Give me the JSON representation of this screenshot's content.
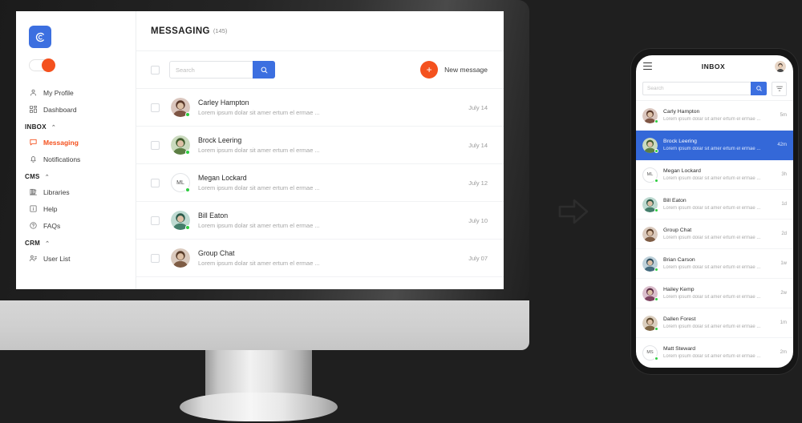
{
  "colors": {
    "accent_orange": "#f4511e",
    "accent_blue": "#3c6fe0",
    "selected_blue": "#3468d8",
    "online_green": "#2ecc40",
    "background": "#1f1f1f"
  },
  "desktop": {
    "sidebar": {
      "logo_letter": "C",
      "toggle_state": "on",
      "items": [
        {
          "label": "My Profile",
          "icon": "user-icon",
          "active": false
        },
        {
          "label": "Dashboard",
          "icon": "grid-icon",
          "active": false
        }
      ],
      "groups": [
        {
          "label": "INBOX",
          "chevron": "⌃",
          "items": [
            {
              "label": "Messaging",
              "icon": "chat-bubble-icon",
              "active": true
            },
            {
              "label": "Notifications",
              "icon": "bell-icon",
              "active": false
            }
          ]
        },
        {
          "label": "CMS",
          "chevron": "⌃",
          "items": [
            {
              "label": "Libraries",
              "icon": "books-icon",
              "active": false
            },
            {
              "label": "Help",
              "icon": "info-box-icon",
              "active": false
            },
            {
              "label": "FAQs",
              "icon": "question-circle-icon",
              "active": false
            }
          ]
        },
        {
          "label": "CRM",
          "chevron": "⌃",
          "items": [
            {
              "label": "User List",
              "icon": "user-list-icon",
              "active": false
            }
          ]
        }
      ]
    },
    "header": {
      "title": "MESSAGING",
      "count": "(145)"
    },
    "toolbar": {
      "select_all_checked": false,
      "search_value": "",
      "search_placeholder": "Search",
      "search_icon": "search-icon",
      "new_message_label": "New message",
      "new_message_icon": "plus-icon"
    },
    "messages": [
      {
        "name": "Carley Hampton",
        "preview": "Lorem ipsum dolar sit amer ertum el ermae ...",
        "date": "July 14",
        "avatar_type": "photo",
        "avatar_hue": 18,
        "online": true,
        "checked": false
      },
      {
        "name": "Brock Leering",
        "preview": "Lorem ipsum dolar sit amer ertum el ermae ...",
        "date": "July 14",
        "avatar_type": "photo",
        "avatar_hue": 95,
        "online": true,
        "checked": false
      },
      {
        "name": "Megan Lockard",
        "preview": "Lorem ipsum dolar sit amer ertum el ermae ...",
        "date": "July 12",
        "avatar_type": "initials",
        "initials": "ML",
        "online": true,
        "checked": false
      },
      {
        "name": "Bill Eaton",
        "preview": "Lorem ipsum dolar sit amer ertum el ermae ...",
        "date": "July 10",
        "avatar_type": "photo",
        "avatar_hue": 160,
        "online": true,
        "checked": false
      },
      {
        "name": "Group Chat",
        "preview": "Lorem ipsum dolar sit amer ertum el ermae ...",
        "date": "July 07",
        "avatar_type": "photo",
        "avatar_hue": 25,
        "online": false,
        "checked": false
      }
    ]
  },
  "mobile": {
    "header": {
      "title": "INBOX",
      "menu_icon": "hamburger-icon",
      "avatar": "user-avatar"
    },
    "search": {
      "value": "",
      "placeholder": "Search",
      "search_icon": "search-icon",
      "filter_icon": "filter-icon"
    },
    "messages": [
      {
        "name": "Carly Hampton",
        "preview": "Lorem ipsum dolar sit amer ertum el ermae ...",
        "time": "5m",
        "avatar_type": "photo",
        "avatar_hue": 18,
        "online": true,
        "selected": false
      },
      {
        "name": "Brock Leering",
        "preview": "Lorem ipsum dolar sit amer ertum el ermae ...",
        "time": "42m",
        "avatar_type": "photo",
        "avatar_hue": 95,
        "online": true,
        "selected": true
      },
      {
        "name": "Megan Lockard",
        "preview": "Lorem ipsum dolar sit amer ertum el ermae ...",
        "time": "3h",
        "avatar_type": "initials",
        "initials": "ML",
        "online": true,
        "selected": false
      },
      {
        "name": "Bill Eaton",
        "preview": "Lorem ipsum dolar sit amer ertum el ermae ...",
        "time": "1d",
        "avatar_type": "photo",
        "avatar_hue": 160,
        "online": true,
        "selected": false
      },
      {
        "name": "Group Chat",
        "preview": "Lorem ipsum dolar sit amer ertum el ermae ...",
        "time": "2d",
        "avatar_type": "photo",
        "avatar_hue": 25,
        "online": false,
        "selected": false
      },
      {
        "name": "Brian Carson",
        "preview": "Lorem ipsum dolar sit amer ertum el ermae ...",
        "time": "1w",
        "avatar_type": "photo",
        "avatar_hue": 200,
        "online": true,
        "selected": false
      },
      {
        "name": "Hailey Kemp",
        "preview": "Lorem ipsum dolar sit amer ertum el ermae ...",
        "time": "2w",
        "avatar_type": "photo",
        "avatar_hue": 330,
        "online": true,
        "selected": false
      },
      {
        "name": "Dallen Forest",
        "preview": "Lorem ipsum dolar sit amer ertum el ermae ...",
        "time": "1m",
        "avatar_type": "photo",
        "avatar_hue": 35,
        "online": true,
        "selected": false
      },
      {
        "name": "Matt Steward",
        "preview": "Lorem ipsum dolar sit amer ertum el ermae ...",
        "time": "2m",
        "avatar_type": "initials",
        "initials": "MS",
        "online": true,
        "selected": false
      }
    ]
  },
  "arrow": {
    "icon": "arrow-right-icon",
    "direction": "right"
  }
}
